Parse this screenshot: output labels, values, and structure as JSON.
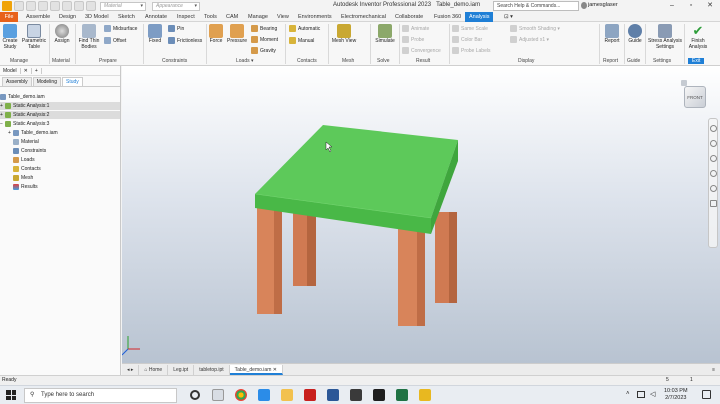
{
  "titlebar": {
    "material_combo": "Material",
    "appearance_combo": "Appearance",
    "app_title": "Autodesk Inventor Professional 2023",
    "document_title": "Table_demo.iam",
    "search_placeholder": "Search Help & Commands...",
    "user_name": "jamesglaser"
  },
  "menu_tabs": [
    "File",
    "Assemble",
    "Design",
    "3D Model",
    "Sketch",
    "Annotate",
    "Inspect",
    "Tools",
    "CAM",
    "Manage",
    "View",
    "Environments",
    "Electromechanical",
    "Collaborate",
    "Fusion 360",
    "Analysis"
  ],
  "ribbon": {
    "manage": {
      "create_study": "Create Study",
      "parametric_table": "Parametric Table",
      "label": "Manage"
    },
    "material": {
      "assign": "Assign",
      "label": "Material"
    },
    "prepare": {
      "find_thin_bodies": "Find Thin Bodies",
      "midsurface": "Midsurface",
      "offset": "Offset",
      "label": "Prepare"
    },
    "constraints": {
      "fixed": "Fixed",
      "pin": "Pin",
      "frictionless": "Frictionless",
      "label": "Constraints"
    },
    "loads": {
      "force": "Force",
      "pressure": "Pressure",
      "bearing": "Bearing",
      "moment": "Moment",
      "gravity": "Gravity",
      "label": "Loads"
    },
    "contacts": {
      "automatic": "Automatic",
      "manual": "Manual",
      "label": "Contacts"
    },
    "mesh": {
      "mesh_view": "Mesh View",
      "label": "Mesh"
    },
    "solve": {
      "simulate": "Simulate",
      "label": "Solve"
    },
    "result": {
      "animate": "Animate",
      "probe": "Probe",
      "convergence": "Convergence",
      "label": "Result"
    },
    "display": {
      "same_scale": "Same Scale",
      "color_bar": "Color Bar",
      "probe_labels": "Probe Labels",
      "smooth_shading": "Smooth Shading",
      "adjusted": "Adjusted x1",
      "label": "Display"
    },
    "report": {
      "report": "Report",
      "label": "Report"
    },
    "guide": {
      "guide": "Guide",
      "label": "Guide"
    },
    "settings": {
      "stress_analysis_settings": "Stress Analysis Settings",
      "label": "Settings"
    },
    "exit": {
      "finish_analysis": "Finish Analysis",
      "label": "Exit"
    }
  },
  "browser": {
    "header_tab": "Model",
    "add_tab": "+",
    "tabs": [
      "Assembly",
      "Modeling",
      "Study"
    ],
    "tree": [
      "Table_demo.iam",
      "Static Analysis:1",
      "Static Analysis:2",
      "Static Analysis:3",
      "Table_demo.iam",
      "Material",
      "Constraints",
      "Loads",
      "Contacts",
      "Mesh",
      "Results"
    ]
  },
  "viewcube": {
    "face": "FRONT"
  },
  "doc_tabs": [
    "Home",
    "Leg.ipt",
    "tabletop.ipt",
    "Table_demo.iam"
  ],
  "status": {
    "text": "Ready",
    "right_a": "5",
    "right_b": "1"
  },
  "taskbar": {
    "search_placeholder": "Type here to search",
    "time": "10:03 PM",
    "date": "2/7/2023"
  },
  "colors": {
    "tabletop": "#5dc95a",
    "leg": "#d8825a",
    "accent": "#1f7fd6",
    "file_tab": "#e8611a"
  }
}
